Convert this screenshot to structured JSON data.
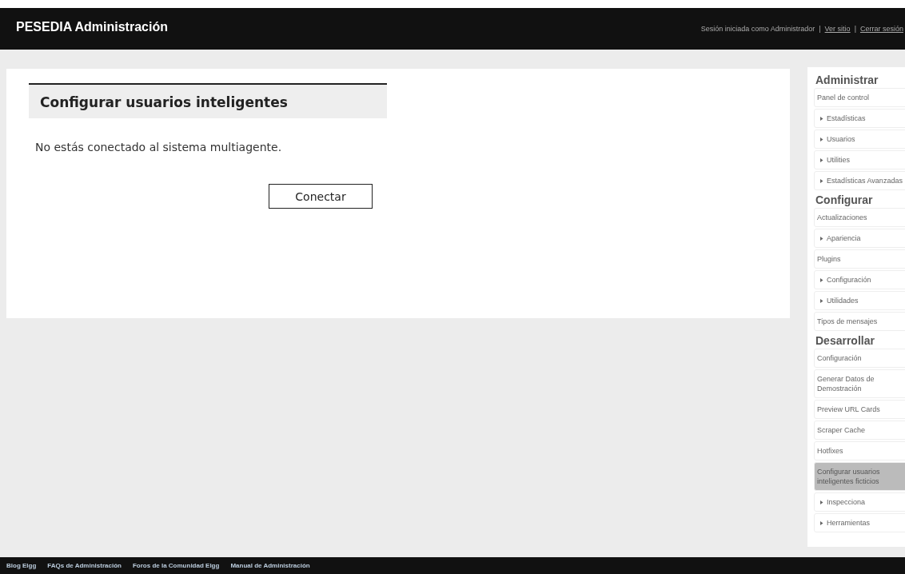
{
  "header": {
    "title": "PESEDIA Administración",
    "session_text": "Sesión iniciada como Administrador",
    "separator": "|",
    "links": [
      "Ver sitio",
      "Cerrar sesión"
    ]
  },
  "main": {
    "title": "Configurar usuarios inteligentes",
    "message": "No estás conectado al sistema multiagente.",
    "button": "Conectar"
  },
  "sidebar": {
    "sections": [
      {
        "title": "Administrar",
        "items": [
          {
            "label": "Panel de control",
            "kind": "link",
            "selected": false
          },
          {
            "label": "Estadísticas",
            "kind": "submenu",
            "selected": false
          },
          {
            "label": "Usuarios",
            "kind": "submenu",
            "selected": false
          },
          {
            "label": "Utilities",
            "kind": "submenu",
            "selected": false
          },
          {
            "label": "Estadísticas Avanzadas",
            "kind": "submenu",
            "selected": false
          }
        ]
      },
      {
        "title": "Configurar",
        "items": [
          {
            "label": "Actualizaciones",
            "kind": "link",
            "selected": false
          },
          {
            "label": "Apariencia",
            "kind": "submenu",
            "selected": false
          },
          {
            "label": "Plugins",
            "kind": "link",
            "selected": false
          },
          {
            "label": "Configuración",
            "kind": "submenu",
            "selected": false
          },
          {
            "label": "Utilidades",
            "kind": "submenu",
            "selected": false
          },
          {
            "label": "Tipos de mensajes",
            "kind": "link",
            "selected": false
          }
        ]
      },
      {
        "title": "Desarrollar",
        "items": [
          {
            "label": "Configuración",
            "kind": "link",
            "selected": false
          },
          {
            "label": "Generar Datos de Demostración",
            "kind": "link",
            "selected": false
          },
          {
            "label": "Preview URL Cards",
            "kind": "link",
            "selected": false
          },
          {
            "label": "Scraper Cache",
            "kind": "link",
            "selected": false
          },
          {
            "label": "Hotfixes",
            "kind": "link",
            "selected": false
          },
          {
            "label": "Configurar usuarios inteligentes ficticios",
            "kind": "link",
            "selected": true
          },
          {
            "label": "Inspecciona",
            "kind": "submenu",
            "selected": false
          },
          {
            "label": "Herramientas",
            "kind": "submenu",
            "selected": false
          }
        ]
      }
    ]
  },
  "footer": {
    "links": [
      "Blog Elgg",
      "FAQs de Administración",
      "Foros de la Comunidad Elgg",
      "Manual de Administración"
    ]
  }
}
